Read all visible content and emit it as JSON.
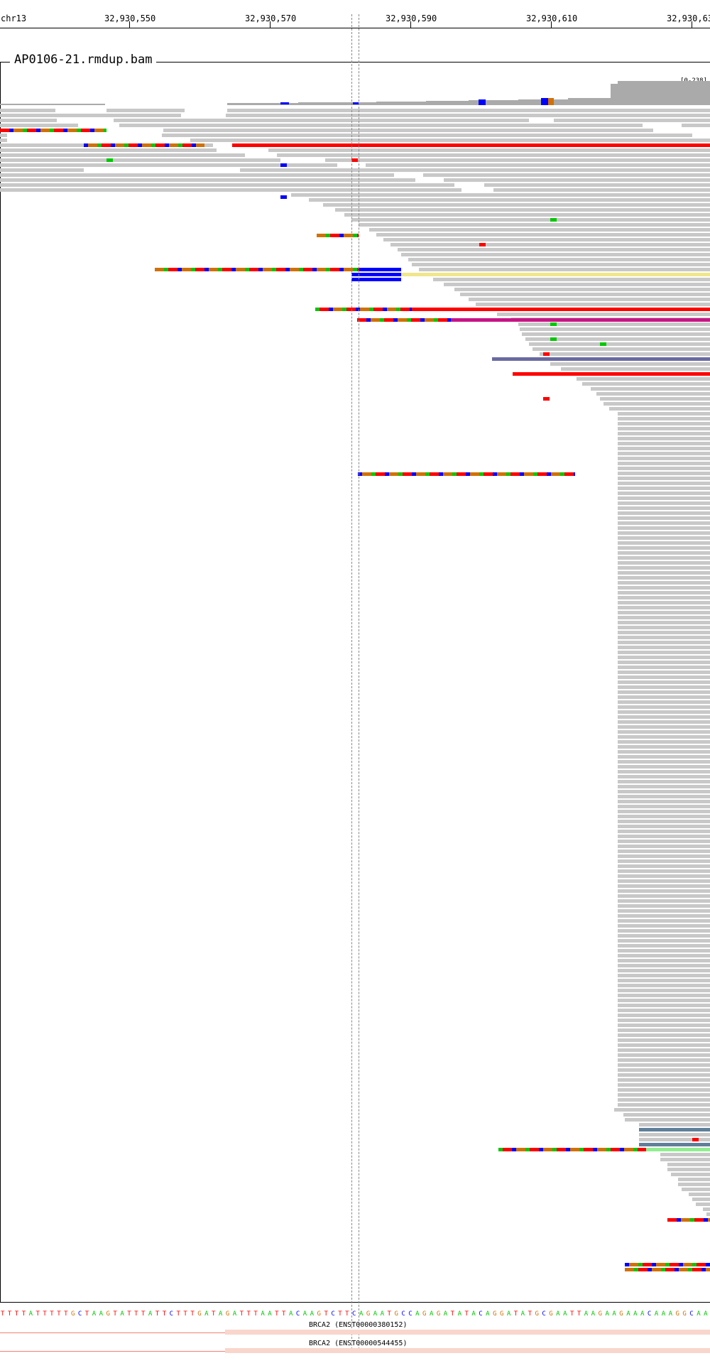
{
  "ruler": {
    "chrom": "chr13",
    "positions": [
      "32,930,550",
      "32,930,570",
      "32,930,590",
      "32,930,610",
      "32,930,63"
    ]
  },
  "track": {
    "title": "AP0106-21.rmdup.bam",
    "coverage_range": "[0-238]"
  },
  "sequence": "TTTTATTTTTGCTAAGTATTTATTCTTTGATAGATTTAATTACAAGTCTTCAGAATGCCAGAGATATACAGGATATGCGAATTAAGAAGAAACAAAGGCAA",
  "transcripts": [
    {
      "label": "BRCA2 (ENST00000380152)"
    },
    {
      "label": "BRCA2 (ENST00000544455)"
    }
  ],
  "colors": {
    "read": "#c8c8c8",
    "coverage": "#aaaaaa",
    "A": "#00c800",
    "C": "#0000ff",
    "G": "#d17105",
    "T": "#ff0000",
    "gene": "#f08070"
  }
}
